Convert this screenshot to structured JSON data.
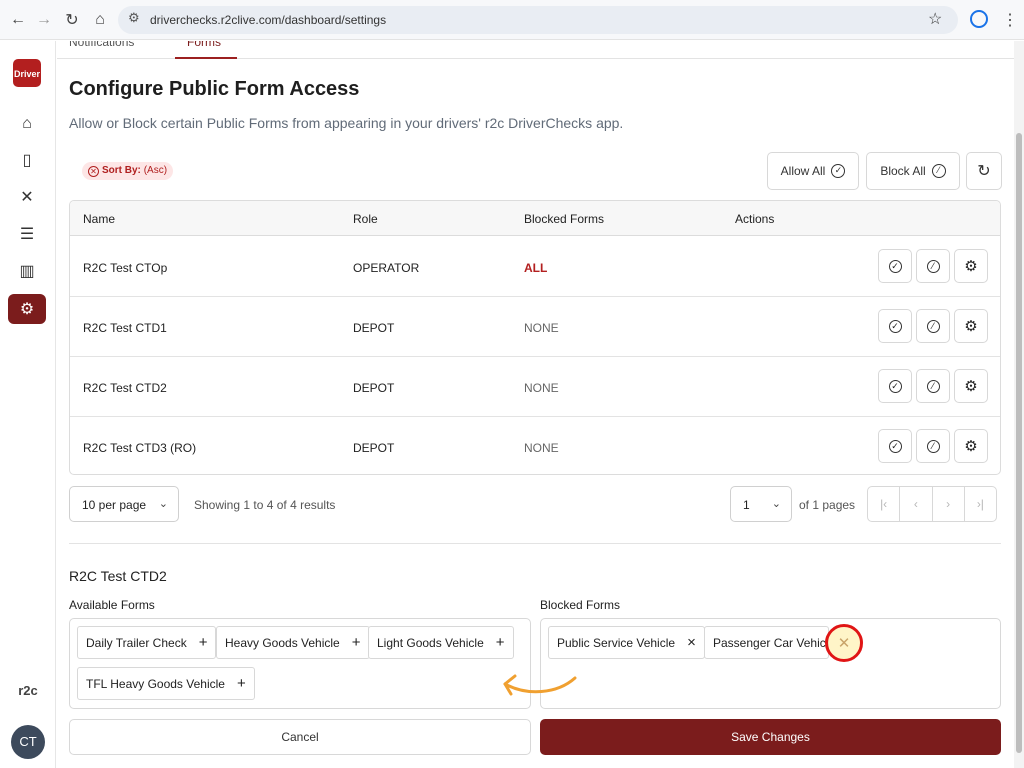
{
  "browser": {
    "url": "driverchecks.r2clive.com/dashboard/settings"
  },
  "sidebar": {
    "logo_text": "Driver",
    "items": [
      {
        "icon": "home-icon"
      },
      {
        "icon": "clipboard-icon"
      },
      {
        "icon": "tools-icon"
      },
      {
        "icon": "list-icon"
      },
      {
        "icon": "chart-icon"
      },
      {
        "icon": "gear-icon",
        "active": true
      }
    ],
    "bottom_logo": "r2c",
    "avatar_initials": "CT"
  },
  "tabs": [
    {
      "label": "Notifications"
    },
    {
      "label": "Forms",
      "active": true
    }
  ],
  "page": {
    "title": "Configure Public Form Access",
    "subtitle": "Allow or Block certain Public Forms from appearing in your drivers' r2c DriverChecks app."
  },
  "sort_chip": {
    "label": "Sort By:",
    "value": "(Asc)"
  },
  "toolbar": {
    "allow_all": "Allow All",
    "block_all": "Block All"
  },
  "table": {
    "headers": [
      "Name",
      "Role",
      "Blocked Forms",
      "Actions"
    ],
    "rows": [
      {
        "name": "R2C Test CTOp",
        "role": "OPERATOR",
        "blocked": "ALL"
      },
      {
        "name": "R2C Test CTD1",
        "role": "DEPOT",
        "blocked": "NONE"
      },
      {
        "name": "R2C Test CTD2",
        "role": "DEPOT",
        "blocked": "NONE"
      },
      {
        "name": "R2C Test CTD3 (RO)",
        "role": "DEPOT",
        "blocked": "NONE"
      }
    ]
  },
  "pagination": {
    "per_page": "10 per page",
    "showing": "Showing 1 to 4 of 4 results",
    "current_page": "1",
    "of_pages": "of 1 pages"
  },
  "editor": {
    "selected_name": "R2C Test CTD2",
    "available_label": "Available Forms",
    "blocked_label": "Blocked Forms",
    "available_forms": [
      "Daily Trailer Check",
      "Heavy Goods Vehicle",
      "Light Goods Vehicle",
      "TFL Heavy Goods Vehicle"
    ],
    "blocked_forms": [
      "Public Service Vehicle",
      "Passenger Car Vehicle"
    ],
    "cancel_label": "Cancel",
    "save_label": "Save Changes"
  },
  "colors": {
    "accent": "#7b1c1c",
    "danger": "#b32020",
    "annotation_ring": "#e01515",
    "annotation_arrow": "#f0a030"
  }
}
